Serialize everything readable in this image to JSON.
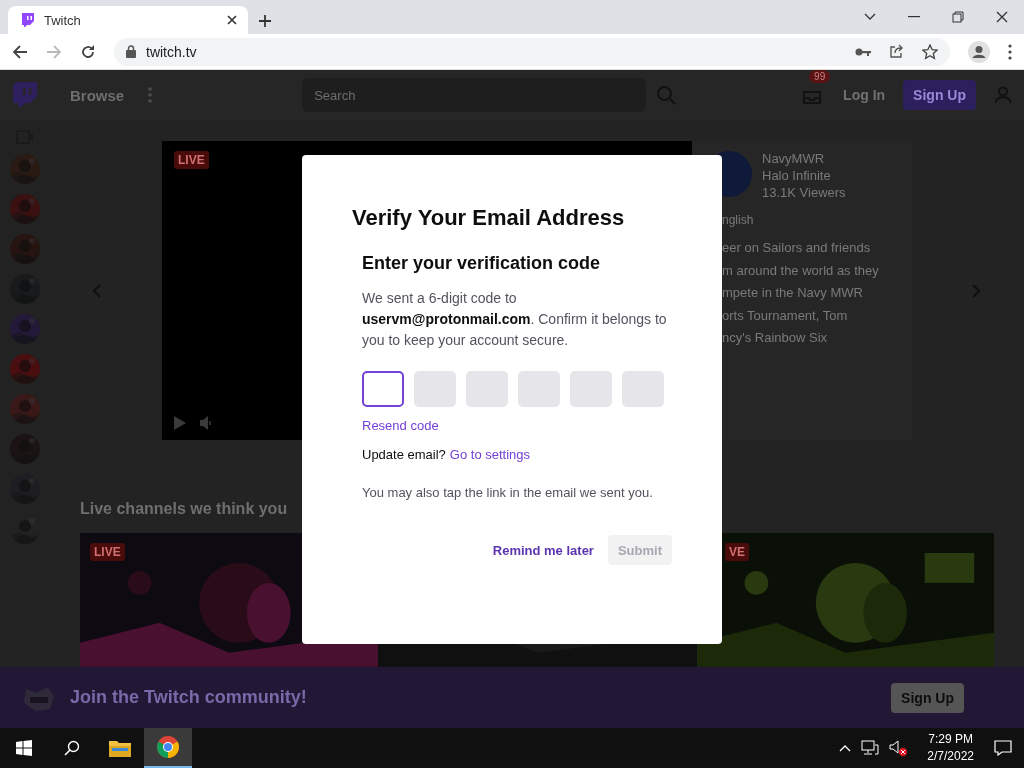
{
  "browser": {
    "tab": {
      "title": "Twitch"
    },
    "address": "twitch.tv",
    "forward_disabled": true
  },
  "site_nav": {
    "browse": "Browse",
    "search": {
      "placeholder": "Search"
    },
    "notification_count": "99",
    "login": "Log In",
    "signup": "Sign Up"
  },
  "sidebar": {
    "channels": [
      {
        "kind": "picture"
      },
      {
        "kind": "picture"
      },
      {
        "kind": "picture"
      },
      {
        "kind": "picture"
      },
      {
        "kind": "picture"
      },
      {
        "kind": "picture"
      },
      {
        "kind": "picture"
      },
      {
        "kind": "picture"
      },
      {
        "kind": "picture"
      },
      {
        "kind": "picture"
      }
    ]
  },
  "featured": {
    "live_badge": "LIVE",
    "channel": "NavyMWR",
    "game": "Halo Infinite",
    "viewers": "13.1K Viewers",
    "tag": "nglish",
    "description": [
      "eer on Sailors and friends",
      "m around the world as they",
      "mpete in the Navy MWR",
      "orts Tournament, Tom",
      "ncy's Rainbow Six"
    ]
  },
  "section_title": "Live channels we think you",
  "cards": [
    {
      "kind": "picture",
      "live_badge": "LIVE"
    },
    {
      "kind": "picture"
    },
    {
      "kind": "picture",
      "live_badge": "VE"
    }
  ],
  "banner": {
    "text": "Join the Twitch community!",
    "button": "Sign Up"
  },
  "modal": {
    "title": "Verify Your Email Address",
    "subtitle": "Enter your verification code",
    "message": "We sent a 6-digit code to **uservm@protonmail.com**. Confirm it belongs to you to keep your account secure.",
    "code_boxes": [
      {
        "focused": true
      },
      {
        "focused": false
      },
      {
        "focused": false
      },
      {
        "focused": false
      },
      {
        "focused": false
      },
      {
        "focused": false
      }
    ],
    "resend": "Resend code",
    "update_prompt": "Update email?",
    "settings_link": "Go to settings",
    "note": "You may also tap the link in the email we sent you.",
    "remind": "Remind me later",
    "submit": {
      "label": "Submit",
      "disabled": true
    }
  },
  "taskbar": {
    "apps": [
      {
        "kind": "folder",
        "selected": false
      },
      {
        "kind": "browser",
        "selected": true
      }
    ],
    "time": "7:29 PM",
    "date": "2/7/2022"
  }
}
